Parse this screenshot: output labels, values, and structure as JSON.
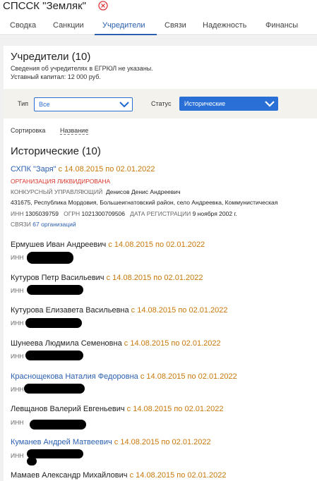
{
  "header": {
    "company_name": "СПССК \"Земляк\""
  },
  "tabs": [
    {
      "label": "Сводка"
    },
    {
      "label": "Санкции"
    },
    {
      "label": "Учредители"
    },
    {
      "label": "Связи"
    },
    {
      "label": "Надежность"
    },
    {
      "label": "Финансы"
    }
  ],
  "section": {
    "title": "Учредители (10)",
    "egrul_note": "Сведения об учредителях в ЕГРЮЛ не указаны.",
    "capital": "Уставный капитал: 12 000 руб."
  },
  "filters": {
    "type_label": "Тип",
    "type_value": "Все",
    "status_label": "Статус",
    "status_value": "Исторические"
  },
  "sort": {
    "label": "Сортировка",
    "value": "Название"
  },
  "group_title": "Исторические (10)",
  "org": {
    "name": "СХПК \"Заря\"",
    "dates": "с 14.08.2015 по 02.01.2022",
    "status": "ОРГАНИЗАЦИЯ ЛИКВИДИРОВАНА",
    "manager_label": "КОНКУРСНЫЙ УПРАВЛЯЮЩИЙ",
    "manager_name": "Денисов Денис Андреевич",
    "address": "431675, Республика Мордовия, Большеигнатовский район, село Андреевка, Коммунистическая",
    "inn_label": "ИНН",
    "inn": "1305039759",
    "ogrn_label": "ОГРН",
    "ogrn": "1021300709506",
    "reg_label": "ДАТА РЕГИСТРАЦИИ",
    "reg_date": "9 ноября 2002 г.",
    "links_label": "СВЯЗИ",
    "links_value": "67 организаций"
  },
  "inn_label": "ИНН",
  "persons": [
    {
      "name": "Ермушев Иван Андреевич",
      "dates": "с 14.08.2015 по 02.01.2022",
      "link": false
    },
    {
      "name": "Кутуров Петр Васильевич",
      "dates": "с 14.08.2015 по 02.01.2022",
      "link": false
    },
    {
      "name": "Кутурова Елизавета Васильевна",
      "dates": "с 14.08.2015 по 02.01.2022",
      "link": false
    },
    {
      "name": "Шунеева Людмила Семеновна",
      "dates": "с 14.08.2015 по 02.01.2022",
      "link": false
    },
    {
      "name": "Краснощекова Наталия Федоровна",
      "dates": "с 14.08.2015 по 02.01.2022",
      "link": true
    },
    {
      "name": "Левщанов Валерий Евгеньевич",
      "dates": "с 14.08.2015 по 02.01.2022",
      "link": false
    },
    {
      "name": "Куманев Андрей Матвеевич",
      "dates": "с 14.08.2015 по 02.01.2022",
      "link": true
    },
    {
      "name": "Мамаев Александр Михайлович",
      "dates": "с 14.08.2015 по 02.01.2022",
      "link": false
    }
  ],
  "colors": {
    "accent": "#2a5fb0",
    "date": "#c8780a",
    "danger": "#d9342b"
  }
}
